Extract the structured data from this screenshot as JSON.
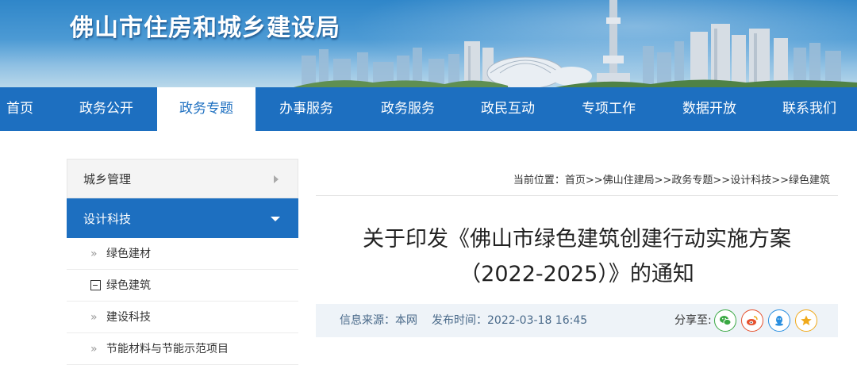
{
  "site": {
    "title": "佛山市住房和城乡建设局"
  },
  "nav": {
    "items": [
      {
        "label": "首页"
      },
      {
        "label": "政务公开"
      },
      {
        "label": "政务专题",
        "active": true
      },
      {
        "label": "办事服务"
      },
      {
        "label": "政务服务"
      },
      {
        "label": "政民互动"
      },
      {
        "label": "专项工作"
      },
      {
        "label": "数据开放"
      },
      {
        "label": "联系我们"
      }
    ]
  },
  "sidebar": {
    "sections": [
      {
        "label": "城乡管理",
        "icon": "chevron-right-icon"
      },
      {
        "label": "设计科技",
        "icon": "chevron-down-icon",
        "active": true
      }
    ],
    "subitems": [
      {
        "label": "绿色建材",
        "icon": "double-chevron-right-icon"
      },
      {
        "label": "绿色建筑",
        "icon": "minus-square-icon",
        "current": true
      },
      {
        "label": "建设科技",
        "icon": "double-chevron-right-icon"
      },
      {
        "label": "节能材料与节能示范项目",
        "icon": "double-chevron-right-icon"
      }
    ]
  },
  "breadcrumb": {
    "prefix": "当前位置：",
    "path": "首页>>佛山住建局>>政务专题>>设计科技>>绿色建筑"
  },
  "article": {
    "title_line1": "关于印发《佛山市绿色建筑创建行动实施方案",
    "title_line2": "（2022-2025）》的通知"
  },
  "meta": {
    "source": "信息来源：本网",
    "time": "发布时间：2022-03-18 16:45",
    "share_label": "分享至:",
    "share_targets": [
      {
        "name": "wechat-icon",
        "color": "#3aa843"
      },
      {
        "name": "weibo-icon",
        "color": "#e6502d"
      },
      {
        "name": "qq-icon",
        "color": "#2a8fe0"
      },
      {
        "name": "qzone-icon",
        "color": "#f0a91a"
      }
    ]
  },
  "colors": {
    "primary": "#1d6fc0",
    "meta_bg": "#eef3f8"
  }
}
